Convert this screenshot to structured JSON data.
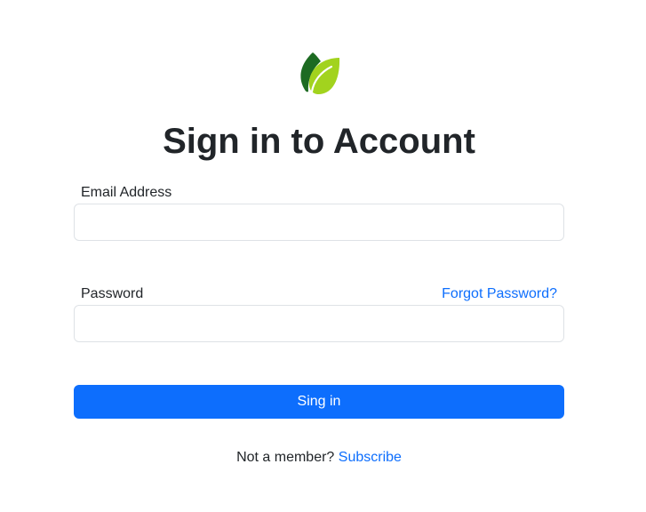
{
  "logo": {
    "icon": "leaf-icon",
    "colors": {
      "dark_leaf": "#1d6b22",
      "light_leaf": "#a2d31e"
    }
  },
  "title": "Sign in to Account",
  "form": {
    "email_label": "Email Address",
    "email_value": "",
    "email_placeholder": "",
    "password_label": "Password",
    "password_value": "",
    "password_placeholder": "",
    "forgot_password": "Forgot Password?",
    "submit_label": "Sing in"
  },
  "footer": {
    "prompt": "Not a member?",
    "subscribe_link": "Subscribe"
  },
  "colors": {
    "accent": "#0d6efd",
    "text": "#212529",
    "input_border": "#dee2e6"
  }
}
